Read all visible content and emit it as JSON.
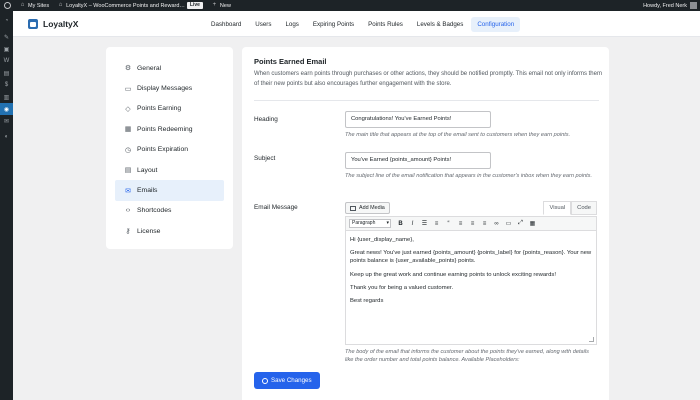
{
  "admin_bar": {
    "my_sites": "My Sites",
    "site_name": "LoyaltyX – WooCommerce Points and Reward…",
    "live_badge": "Live",
    "new_label": "New",
    "greeting": "Howdy, Fred Nerk"
  },
  "app": {
    "brand": "LoyaltyX",
    "tabs": [
      {
        "label": "Dashboard"
      },
      {
        "label": "Users"
      },
      {
        "label": "Logs"
      },
      {
        "label": "Expiring Points"
      },
      {
        "label": "Points Rules"
      },
      {
        "label": "Levels & Badges"
      },
      {
        "label": "Configuration",
        "active": true
      }
    ]
  },
  "settings_nav": {
    "items": [
      {
        "label": "General",
        "icon": "gear-icon"
      },
      {
        "label": "Display Messages",
        "icon": "message-icon"
      },
      {
        "label": "Points Earning",
        "icon": "tag-icon"
      },
      {
        "label": "Points Redeeming",
        "icon": "gift-icon"
      },
      {
        "label": "Points Expiration",
        "icon": "clock-icon"
      },
      {
        "label": "Layout",
        "icon": "layout-icon"
      },
      {
        "label": "Emails",
        "icon": "email-icon",
        "active": true
      },
      {
        "label": "Shortcodes",
        "icon": "code-icon"
      },
      {
        "label": "License",
        "icon": "key-icon"
      }
    ]
  },
  "section": {
    "title": "Points Earned Email",
    "description": "When customers earn points through purchases or other actions, they should be notified promptly. This email not only informs them of their new points but also encourages further engagement with the store."
  },
  "heading": {
    "label": "Heading",
    "value": "Congratulations! You've Earned Points!",
    "help": "The main title that appears at the top of the email sent to customers when they earn points."
  },
  "subject": {
    "label": "Subject",
    "value": "You've Earned {points_amount} Points!",
    "help": "The subject line of the email notification that appears in the customer's inbox when they earn points."
  },
  "email_message": {
    "label": "Email Message",
    "add_media": "Add Media",
    "mode_visual": "Visual",
    "mode_code": "Code",
    "format_select": "Paragraph",
    "paragraphs": [
      "Hi {user_display_name},",
      "Great news! You've just earned {points_amount} {points_label} for {points_reason}. Your new points balance is {user_available_points} points.",
      "Keep up the great work and continue earning points to unlock exciting rewards!",
      "Thank you for being a valued customer.",
      "Best regards"
    ],
    "help": "The body of the email that informs the customer about the points they've earned, along with details like the order number and total points balance. Available Placeholders:"
  },
  "save_button": "Save Changes",
  "colors": {
    "accent": "#2563eb",
    "admin_bar": "#1d2327",
    "active_bg": "#e7f0fb"
  }
}
